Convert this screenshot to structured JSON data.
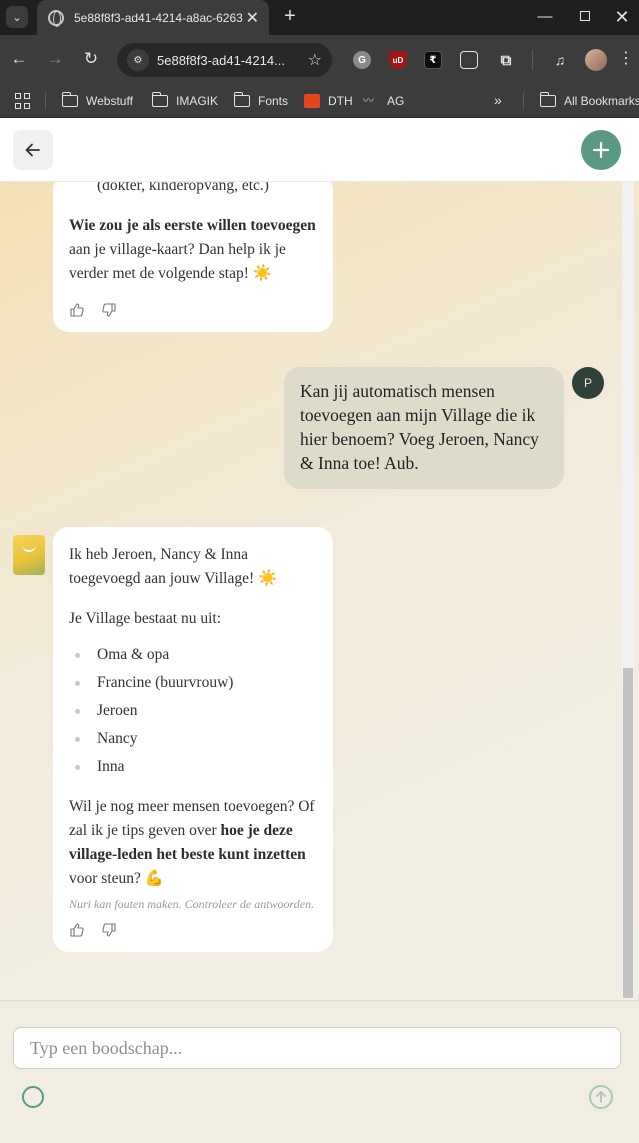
{
  "browser": {
    "tab_title": "5e88f8f3-ad41-4214-a8ac-6263",
    "url": "5e88f8f3-ad41-4214...",
    "bookmarks": [
      "Webstuff",
      "IMAGIK",
      "Fonts",
      "DTH",
      "AG"
    ],
    "all_bookmarks": "All Bookmarks"
  },
  "chat": {
    "bot_message_1": {
      "list_tail": "(dokter, kinderopvang, etc.)",
      "q_bold": "Wie zou je als eerste willen toevoegen",
      "q_rest": " aan je village-kaart? Dan help ik je verder met de volgende stap! ☀️"
    },
    "user_message": {
      "text": "Kan jij automatisch mensen toevoegen aan mijn Village die ik hier benoem? Voeg Jeroen, Nancy & Inna toe! Aub.",
      "avatar_initial": "P"
    },
    "bot_message_2": {
      "intro": "Ik heb Jeroen, Nancy & Inna toegevoegd aan jouw Village! ☀️",
      "list_heading": "Je Village bestaat nu uit:",
      "village_members": [
        "Oma & opa",
        "Francine (buurvrouw)",
        "Jeroen",
        "Nancy",
        "Inna"
      ],
      "outro_start": "Wil je nog meer mensen toevoegen? Of zal ik je tips geven over ",
      "outro_bold": "hoe je deze village-leden het beste kunt inzetten",
      "outro_end": " voor steun? 💪",
      "disclaimer": "Nuri kan fouten maken. Controleer de antwoorden."
    }
  },
  "composer": {
    "placeholder": "Typ een boodschap..."
  },
  "colors": {
    "accent": "#5a9a82",
    "user_bubble": "#dedbcb",
    "user_avatar": "#2f4038"
  }
}
